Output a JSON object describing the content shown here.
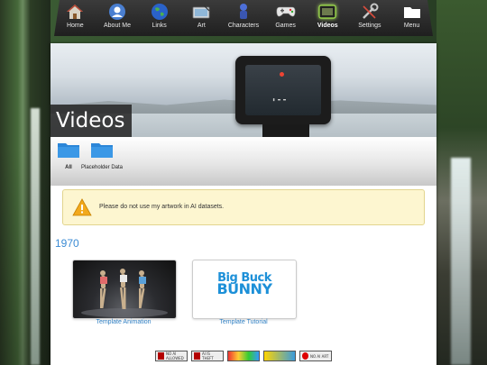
{
  "nav": {
    "items": [
      {
        "label": "Home",
        "icon": "home-icon"
      },
      {
        "label": "About Me",
        "icon": "user-icon"
      },
      {
        "label": "Links",
        "icon": "globe-icon"
      },
      {
        "label": "Art",
        "icon": "tablet-icon"
      },
      {
        "label": "Characters",
        "icon": "character-icon"
      },
      {
        "label": "Games",
        "icon": "gamepad-icon"
      },
      {
        "label": "Videos",
        "icon": "camera-icon",
        "active": true
      },
      {
        "label": "Settings",
        "icon": "wrench-icon"
      },
      {
        "label": "Menu",
        "icon": "folder-icon"
      }
    ]
  },
  "page": {
    "title": "Videos"
  },
  "folders": [
    {
      "label": "All",
      "active": true
    },
    {
      "label": "Placeholder Data",
      "active": false
    }
  ],
  "notice": {
    "text": "Please do not use my artwork in AI datasets."
  },
  "section": {
    "year": "1970"
  },
  "videos": [
    {
      "title": "Template Animation",
      "thumbnail": "dancers-thumbnail"
    },
    {
      "title": "Template Tutorial",
      "thumbnail": "big-buck-bunny-thumbnail",
      "thumb_text": [
        "Big Buck",
        "BUNNY"
      ]
    }
  ],
  "badges": [
    {
      "label": "NO AI ALLOWED"
    },
    {
      "label": "AI IS THEFT"
    },
    {
      "label": ""
    },
    {
      "label": ""
    },
    {
      "label": "NO AI ART"
    }
  ],
  "colors": {
    "link": "#2f7fc3",
    "year": "#3b8bd4",
    "notice_bg": "#fdf6d0",
    "folder": "#2b86d8"
  }
}
